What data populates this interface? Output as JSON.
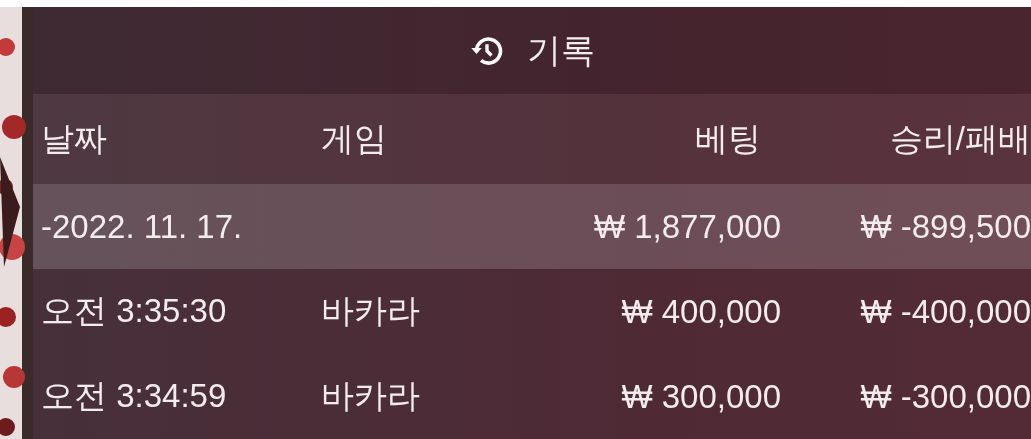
{
  "header": {
    "title": "기록"
  },
  "table": {
    "columns": [
      "날짜",
      "게임",
      "베팅",
      "승리/패배"
    ],
    "rows": [
      {
        "kind": "date",
        "cells": [
          "-2022. 11. 17.",
          "",
          "₩ 1,877,000",
          "₩ -899,500"
        ]
      },
      {
        "kind": "entry",
        "cells": [
          "오전 3:35:30",
          "바카라",
          "₩ 400,000",
          "₩ -400,000"
        ]
      },
      {
        "kind": "entry",
        "cells": [
          "오전 3:34:59",
          "바카라",
          "₩ 300,000",
          "₩ -300,000"
        ]
      }
    ]
  }
}
